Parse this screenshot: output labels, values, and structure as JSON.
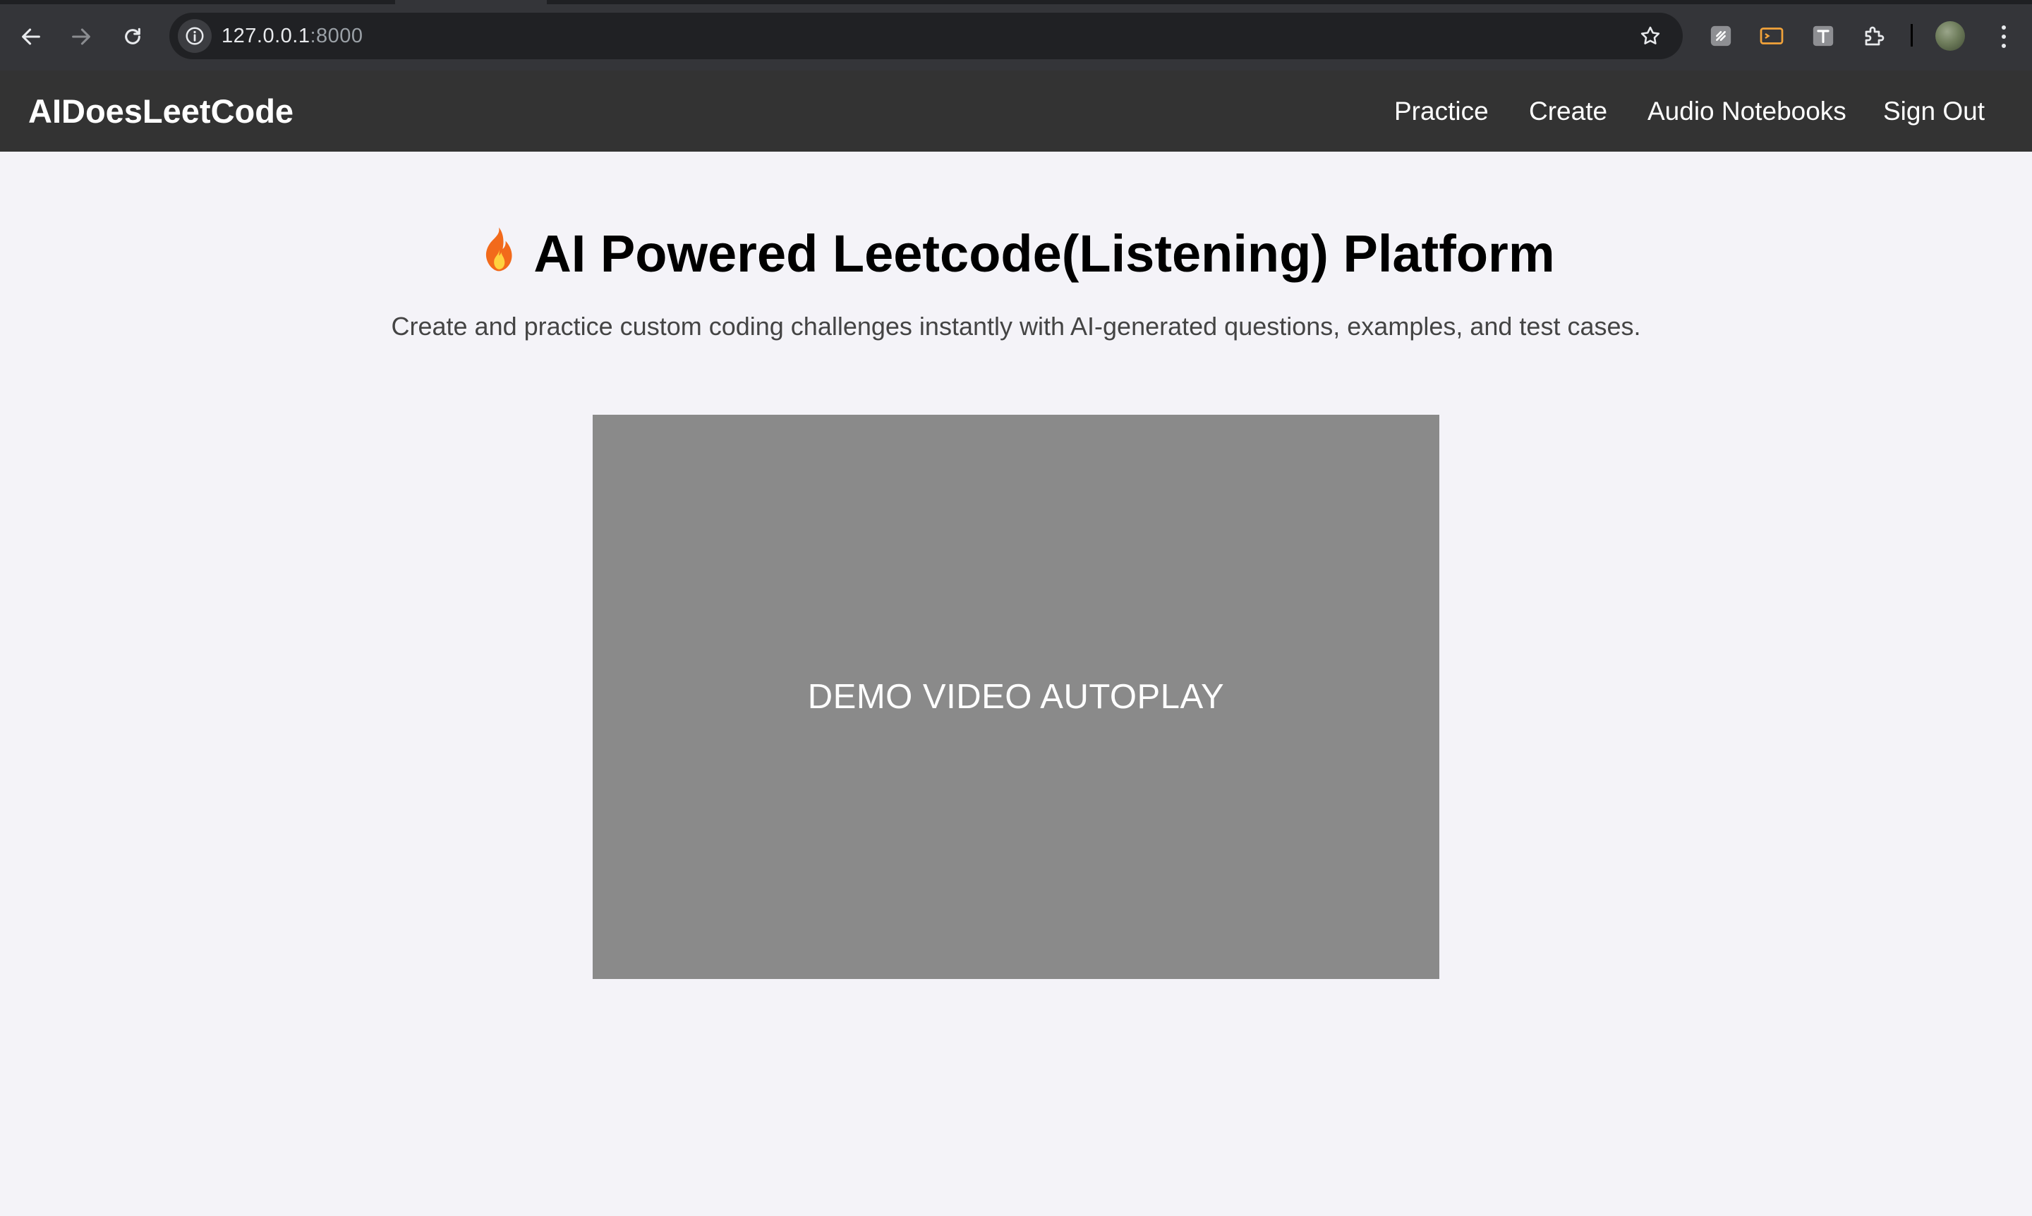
{
  "browser": {
    "url_host": "127.0.0.1",
    "url_port": ":8000",
    "icons": {
      "back": "arrow-left-icon",
      "forward": "arrow-right-icon",
      "reload": "reload-icon",
      "site_info": "info-icon",
      "bookmark": "star-icon",
      "extensions": [
        "extension-a-icon",
        "cast-icon",
        "translate-icon",
        "puzzle-icon"
      ],
      "menu": "kebab-menu-icon"
    }
  },
  "nav": {
    "brand": "AIDoesLeetCode",
    "links": [
      "Practice",
      "Create",
      "Audio Notebooks",
      "Sign Out"
    ]
  },
  "hero": {
    "title": "AI Powered Leetcode(Listening) Platform",
    "title_icon": "fire-emoji",
    "subtitle": "Create and practice custom coding challenges instantly with AI-generated questions, examples, and test cases."
  },
  "video": {
    "label": "DEMO VIDEO AUTOPLAY"
  },
  "colors": {
    "page_bg": "#f4f3f8",
    "navbar_bg": "#333333",
    "video_bg": "#8a8a8a"
  }
}
